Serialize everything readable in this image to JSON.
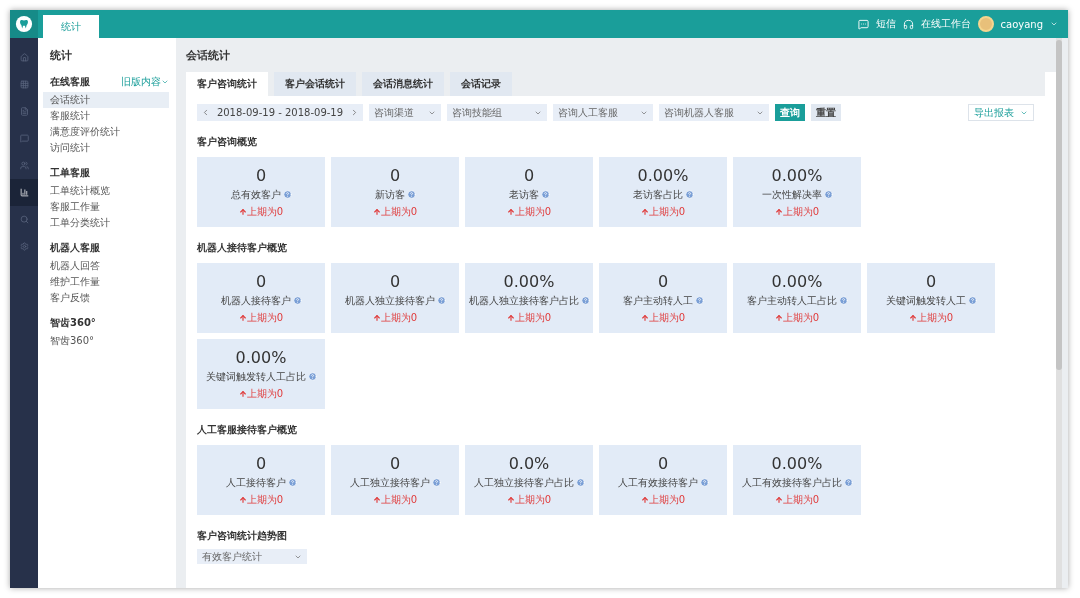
{
  "header": {
    "tabs": [
      {
        "label": "统计",
        "selected": true
      }
    ],
    "sms": "短信",
    "workbench": "在线工作台",
    "user": "caoyang"
  },
  "rail": [
    {
      "selected": false
    },
    {
      "selected": false
    },
    {
      "selected": false
    },
    {
      "selected": false
    },
    {
      "selected": false
    },
    {
      "selected": true
    },
    {
      "selected": false
    },
    {
      "selected": false
    }
  ],
  "sidebar": {
    "title": "统计",
    "groups": [
      {
        "title": "在线客服",
        "link": "旧版内容",
        "items": [
          {
            "label": "会话统计",
            "selected": true
          },
          {
            "label": "客服统计",
            "selected": false
          },
          {
            "label": "满意度评价统计",
            "selected": false
          },
          {
            "label": "访问统计",
            "selected": false
          }
        ]
      },
      {
        "title": "工单客服",
        "items": [
          {
            "label": "工单统计概览",
            "selected": false
          },
          {
            "label": "客服工作量",
            "selected": false
          },
          {
            "label": "工单分类统计",
            "selected": false
          }
        ]
      },
      {
        "title": "机器人客服",
        "items": [
          {
            "label": "机器人回答",
            "selected": false
          },
          {
            "label": "维护工作量",
            "selected": false
          },
          {
            "label": "客户反馈",
            "selected": false
          }
        ]
      },
      {
        "title": "智齿360°",
        "items": [
          {
            "label": "智齿360°",
            "selected": false
          }
        ]
      }
    ]
  },
  "main": {
    "title": "会话统计",
    "tabs": [
      {
        "label": "客户咨询统计",
        "selected": true
      },
      {
        "label": "客户会话统计",
        "selected": false
      },
      {
        "label": "会话消息统计",
        "selected": false
      },
      {
        "label": "会话记录",
        "selected": false
      }
    ],
    "filters": {
      "date_range": "2018-09-19 - 2018-09-19",
      "selects": [
        "咨询渠道",
        "咨询技能组",
        "咨询人工客服",
        "咨询机器人客服"
      ],
      "query": "查询",
      "reset": "重置",
      "export": "导出报表"
    },
    "sections": [
      {
        "title": "客户咨询概览",
        "cards": [
          {
            "value": "0",
            "label": "总有效客户",
            "change": "上期为0"
          },
          {
            "value": "0",
            "label": "新访客",
            "change": "上期为0"
          },
          {
            "value": "0",
            "label": "老访客",
            "change": "上期为0"
          },
          {
            "value": "0.00%",
            "label": "老访客占比",
            "change": "上期为0"
          },
          {
            "value": "0.00%",
            "label": "一次性解决率",
            "change": "上期为0"
          }
        ]
      },
      {
        "title": "机器人接待客户概览",
        "cards": [
          {
            "value": "0",
            "label": "机器人接待客户",
            "change": "上期为0"
          },
          {
            "value": "0",
            "label": "机器人独立接待客户",
            "change": "上期为0"
          },
          {
            "value": "0.00%",
            "label": "机器人独立接待客户占比",
            "change": "上期为0"
          },
          {
            "value": "0",
            "label": "客户主动转人工",
            "change": "上期为0"
          },
          {
            "value": "0.00%",
            "label": "客户主动转人工占比",
            "change": "上期为0"
          },
          {
            "value": "0",
            "label": "关键词触发转人工",
            "change": "上期为0"
          },
          {
            "value": "0.00%",
            "label": "关键词触发转人工占比",
            "change": "上期为0"
          }
        ]
      },
      {
        "title": "人工客服接待客户概览",
        "cards": [
          {
            "value": "0",
            "label": "人工接待客户",
            "change": "上期为0"
          },
          {
            "value": "0",
            "label": "人工独立接待客户",
            "change": "上期为0"
          },
          {
            "value": "0.0%",
            "label": "人工独立接待客户占比",
            "change": "上期为0"
          },
          {
            "value": "0",
            "label": "人工有效接待客户",
            "change": "上期为0"
          },
          {
            "value": "0.00%",
            "label": "人工有效接待客户占比",
            "change": "上期为0"
          }
        ]
      }
    ],
    "trend": {
      "title": "客户咨询统计趋势图",
      "select": "有效客户统计"
    }
  }
}
